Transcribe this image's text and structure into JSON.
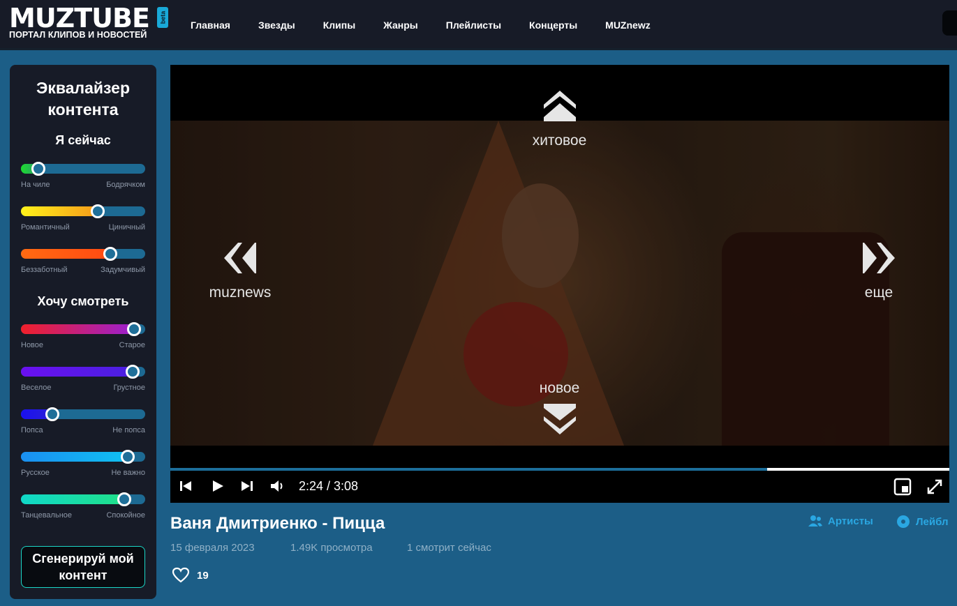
{
  "header": {
    "logo_text": "MUZTUBE",
    "logo_badge": "beta",
    "logo_subtitle": "ПОРТАЛ КЛИПОВ И НОВОСТЕЙ",
    "nav": [
      "Главная",
      "Звезды",
      "Клипы",
      "Жанры",
      "Плейлисты",
      "Концерты",
      "MUZnewz"
    ]
  },
  "sidebar": {
    "title": "Эквалайзер контента",
    "section_now": "Я сейчас",
    "section_watch": "Хочу смотреть",
    "sliders": [
      {
        "left": "На чиле",
        "right": "Бодрячком",
        "value": 0.14,
        "gradient": [
          "#1ddc2d",
          "#2b9b6e"
        ]
      },
      {
        "left": "Романтичный",
        "right": "Циничный",
        "value": 0.62,
        "gradient": [
          "#fff21a",
          "#f59b1a"
        ]
      },
      {
        "left": "Беззаботный",
        "right": "Задумчивый",
        "value": 0.72,
        "gradient": [
          "#ff6a12",
          "#ff4a12"
        ]
      },
      {
        "left": "Новое",
        "right": "Старое",
        "value": 0.91,
        "gradient": [
          "#f0202a",
          "#9a20d0"
        ]
      },
      {
        "left": "Веселое",
        "right": "Грустное",
        "value": 0.9,
        "gradient": [
          "#6a10f0",
          "#4a20e0"
        ]
      },
      {
        "left": "Попса",
        "right": "Не попса",
        "value": 0.25,
        "gradient": [
          "#1a10f0",
          "#2a20d8"
        ]
      },
      {
        "left": "Русское",
        "right": "Не важно",
        "value": 0.86,
        "gradient": [
          "#1a8ff0",
          "#10c0f0"
        ]
      },
      {
        "left": "Танцевальное",
        "right": "Спокойное",
        "value": 0.83,
        "gradient": [
          "#10d8c8",
          "#20e08a"
        ]
      }
    ],
    "generate_button": "Сгенерируй мой контент"
  },
  "player": {
    "up_label": "хитовое",
    "down_label": "новое",
    "left_label": "muznews",
    "right_label": "еще",
    "time": "2:24 / 3:08",
    "progress": 0.766
  },
  "video": {
    "title": "Ваня Дмитриенко - Пицца",
    "date": "15 февраля 2023",
    "views": "1.49K просмотра",
    "watching": "1 смотрит сейчас",
    "likes": "19",
    "artists_link": "Артисты",
    "label_link": "Лейбл"
  },
  "colors": {
    "page_bg": "#1c5e87",
    "panel_bg": "#171b27",
    "accent": "#2aa7e2"
  }
}
